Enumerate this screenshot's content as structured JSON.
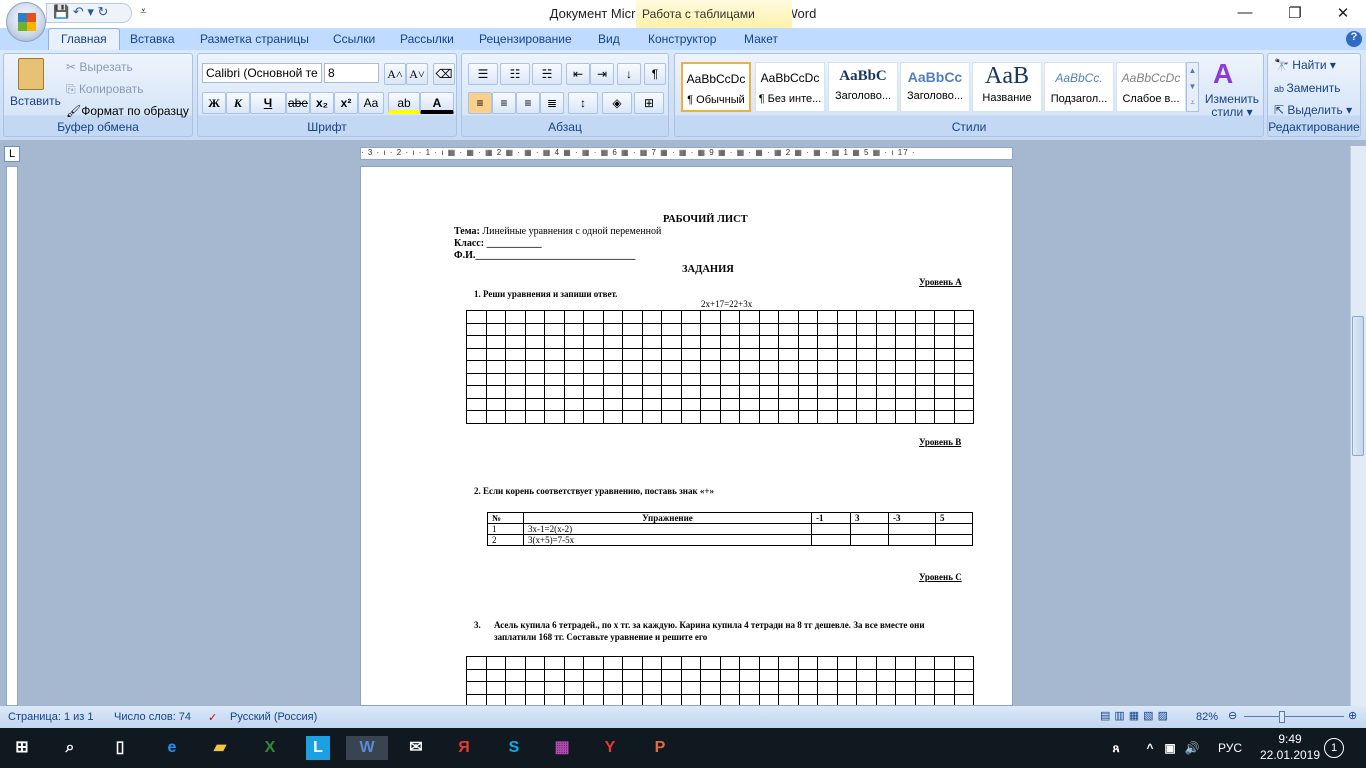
{
  "window": {
    "title": "Документ Microsoft Word (2)  -  Microsoft Word",
    "context_tab": "Работа с таблицами"
  },
  "qat": {
    "save": "💾",
    "undo": "↶ ▾",
    "redo": "↻",
    "more": "⩡"
  },
  "tabs": [
    "Главная",
    "Вставка",
    "Разметка страницы",
    "Ссылки",
    "Рассылки",
    "Рецензирование",
    "Вид",
    "Конструктор",
    "Макет"
  ],
  "clipboard": {
    "paste": "Вставить",
    "cut": "Вырезать",
    "copy": "Копировать",
    "format_painter": "Формат по образцу",
    "label": "Буфер обмена"
  },
  "font": {
    "name": "Calibri (Основной те",
    "size": "8",
    "bold": "Ж",
    "italic": "К",
    "underline": "Ч",
    "strike": "abe",
    "sub": "x₂",
    "sup": "x²",
    "case": "Aa",
    "grow": "A˄",
    "shrink": "A˅",
    "label": "Шрифт"
  },
  "paragraph": {
    "label": "Абзац"
  },
  "styles": {
    "label": "Стили",
    "items": [
      {
        "preview": "AaBbCcDc",
        "name": "¶ Обычный"
      },
      {
        "preview": "AaBbCcDc",
        "name": "¶ Без инте..."
      },
      {
        "preview": "AaBbC",
        "name": "Заголово..."
      },
      {
        "preview": "AaBbCc",
        "name": "Заголово..."
      },
      {
        "preview": "AaB",
        "name": "Название"
      },
      {
        "preview": "AaBbCc.",
        "name": "Подзагол..."
      },
      {
        "preview": "AaBbCcDc",
        "name": "Слабое в..."
      }
    ],
    "change": "Изменить стили ▾"
  },
  "editing": {
    "find": "Найти ▾",
    "replace": "Заменить",
    "select": "Выделить ▾",
    "label": "Редактирование"
  },
  "ruler": {
    "text": "· 3 · ı · 2 · ı · 1 · ı ▦ · ▦ · ▦ 2 ▦ · ▦ · ▦ 4 ▦ · ▦ · ▦ 6 ▦ · ▦ 7 ▦ · ▦ · ▦ 9 ▦ · ▦ · ▦ · ▦ 2 ▦ · ▦ · ▦ 1 ▦ 5 ▦ · ı 17 ·"
  },
  "document": {
    "title": "РАБОЧИЙ ЛИСТ",
    "topic_label": "Тема:",
    "topic": " Линейные уравнения с одной переменной",
    "class_label": "Класс: ___________",
    "name_label": "Ф.И.________________________________",
    "tasks_title": "ЗАДАНИЯ",
    "level_a": "Уровень А",
    "task1": "1.     Реши уравнения и запиши ответ.",
    "equation": "2x+17=22+3x",
    "level_b": "Уровень В",
    "task2": "2.     Если корень соответствует  уравнению, поставь знак «+»",
    "table_headers": [
      "№",
      "Упражнение",
      "-1",
      "3",
      "-3",
      "5"
    ],
    "table_rows": [
      [
        "1",
        "3x-1=2(x-2)",
        "",
        "",
        "",
        ""
      ],
      [
        "2",
        "3(x+5)=7-5x",
        "",
        "",
        "",
        ""
      ]
    ],
    "level_c": "Уровень С",
    "task3_num": "3.",
    "task3_line1": "Асель купила 6 тетрадей., по х тг. за каждую. Карина купила 4 тетради на 8 тг дешевле. За все вместе они",
    "task3_line2": "заплатили 168 тг. Составьте уравнение и решите его"
  },
  "status": {
    "page": "Страница: 1 из 1",
    "words": "Число слов: 74",
    "language": "Русский (Россия)",
    "zoom": "82%",
    "zoom_percent": 82
  },
  "tray": {
    "lang": "РУС",
    "time": "9:49",
    "date": "22.01.2019",
    "notifications": "1"
  }
}
